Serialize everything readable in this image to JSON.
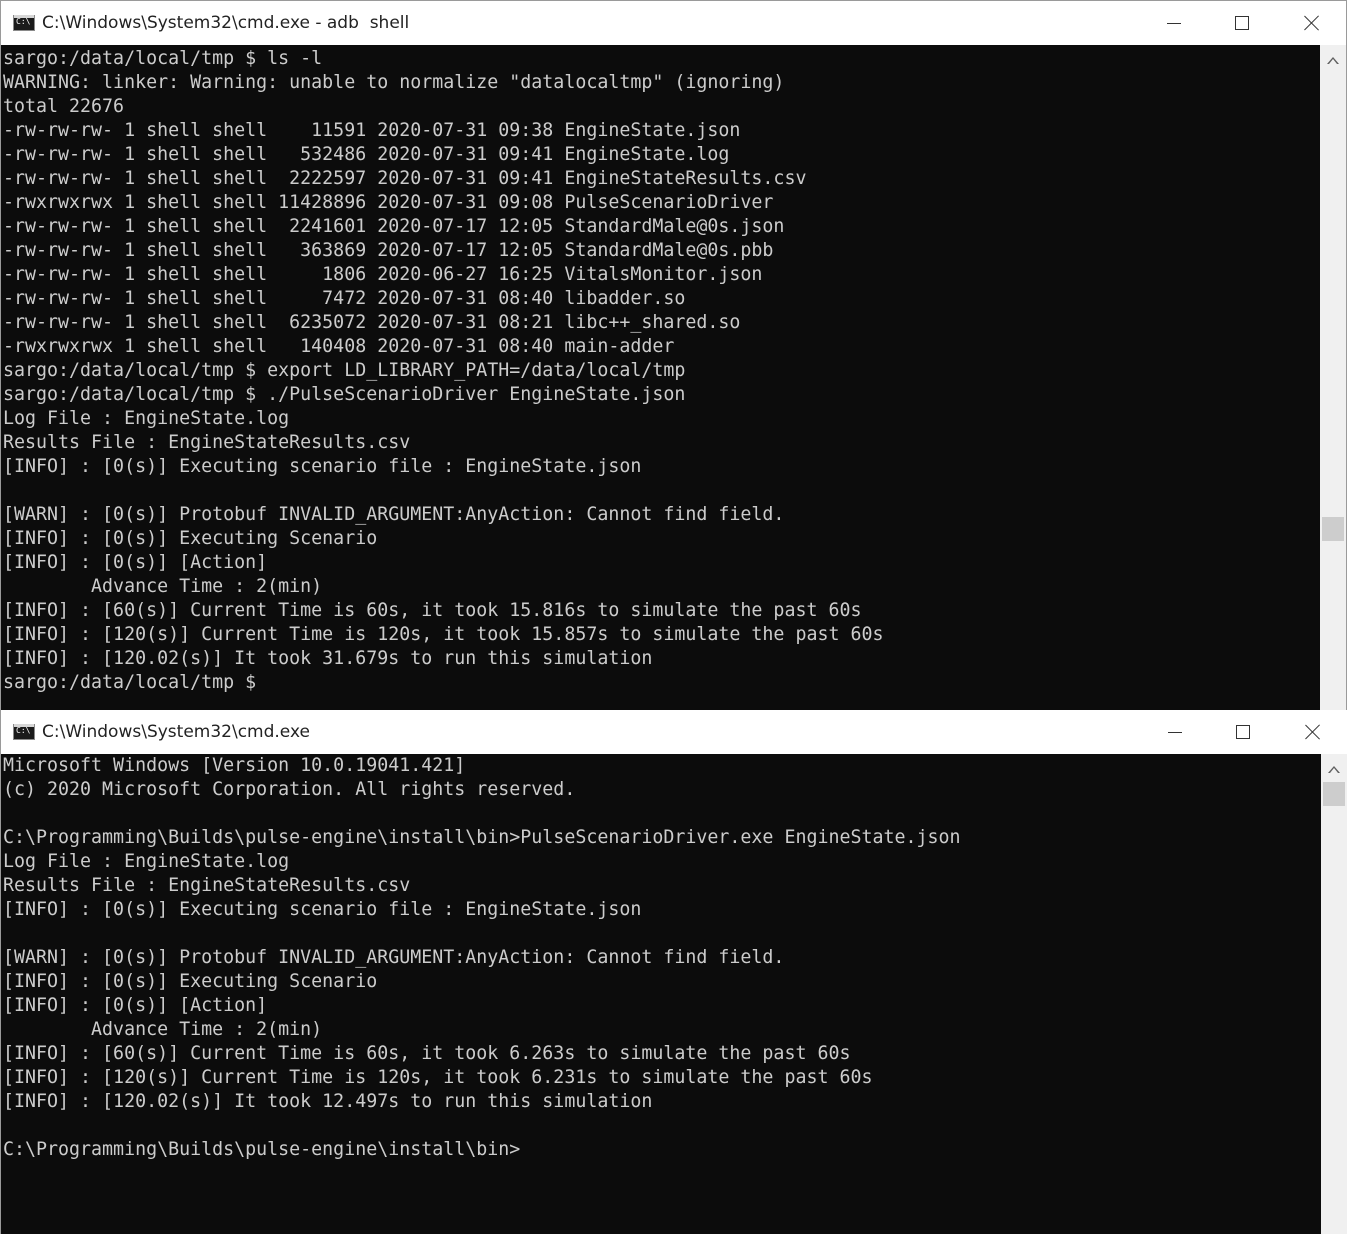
{
  "windows": [
    {
      "title": "C:\\Windows\\System32\\cmd.exe - adb  shell",
      "lines": [
        "sargo:/data/local/tmp $ ls -l",
        "WARNING: linker: Warning: unable to normalize \"datalocaltmp\" (ignoring)",
        "total 22676",
        "-rw-rw-rw- 1 shell shell    11591 2020-07-31 09:38 EngineState.json",
        "-rw-rw-rw- 1 shell shell   532486 2020-07-31 09:41 EngineState.log",
        "-rw-rw-rw- 1 shell shell  2222597 2020-07-31 09:41 EngineStateResults.csv",
        "-rwxrwxrwx 1 shell shell 11428896 2020-07-31 09:08 PulseScenarioDriver",
        "-rw-rw-rw- 1 shell shell  2241601 2020-07-17 12:05 StandardMale@0s.json",
        "-rw-rw-rw- 1 shell shell   363869 2020-07-17 12:05 StandardMale@0s.pbb",
        "-rw-rw-rw- 1 shell shell     1806 2020-06-27 16:25 VitalsMonitor.json",
        "-rw-rw-rw- 1 shell shell     7472 2020-07-31 08:40 libadder.so",
        "-rw-rw-rw- 1 shell shell  6235072 2020-07-31 08:21 libc++_shared.so",
        "-rwxrwxrwx 1 shell shell   140408 2020-07-31 08:40 main-adder",
        "sargo:/data/local/tmp $ export LD_LIBRARY_PATH=/data/local/tmp",
        "sargo:/data/local/tmp $ ./PulseScenarioDriver EngineState.json",
        "Log File : EngineState.log",
        "Results File : EngineStateResults.csv",
        "[INFO] : [0(s)] Executing scenario file : EngineState.json",
        "",
        "[WARN] : [0(s)] Protobuf INVALID_ARGUMENT:AnyAction: Cannot find field.",
        "[INFO] : [0(s)] Executing Scenario",
        "[INFO] : [0(s)] [Action]",
        "        Advance Time : 2(min)",
        "[INFO] : [60(s)] Current Time is 60s, it took 15.816s to simulate the past 60s",
        "[INFO] : [120(s)] Current Time is 120s, it took 15.857s to simulate the past 60s",
        "[INFO] : [120.02(s)] It took 31.679s to run this simulation",
        "sargo:/data/local/tmp $"
      ]
    },
    {
      "title": "C:\\Windows\\System32\\cmd.exe",
      "lines": [
        "Microsoft Windows [Version 10.0.19041.421]",
        "(c) 2020 Microsoft Corporation. All rights reserved.",
        "",
        "C:\\Programming\\Builds\\pulse-engine\\install\\bin>PulseScenarioDriver.exe EngineState.json",
        "Log File : EngineState.log",
        "Results File : EngineStateResults.csv",
        "[INFO] : [0(s)] Executing scenario file : EngineState.json",
        "",
        "[WARN] : [0(s)] Protobuf INVALID_ARGUMENT:AnyAction: Cannot find field.",
        "[INFO] : [0(s)] Executing Scenario",
        "[INFO] : [0(s)] [Action]",
        "        Advance Time : 2(min)",
        "[INFO] : [60(s)] Current Time is 60s, it took 6.263s to simulate the past 60s",
        "[INFO] : [120(s)] Current Time is 120s, it took 6.231s to simulate the past 60s",
        "[INFO] : [120.02(s)] It took 12.497s to run this simulation",
        "",
        "C:\\Programming\\Builds\\pulse-engine\\install\\bin>"
      ]
    }
  ],
  "icons": {
    "app": "cmd-icon",
    "minimize": "minimize-icon",
    "maximize": "maximize-icon",
    "close": "close-icon",
    "scroll_up": "chevron-up-icon"
  },
  "colors": {
    "console_bg": "#0c0c0c",
    "console_text": "#cccccc",
    "titlebar_bg": "#ffffff"
  }
}
